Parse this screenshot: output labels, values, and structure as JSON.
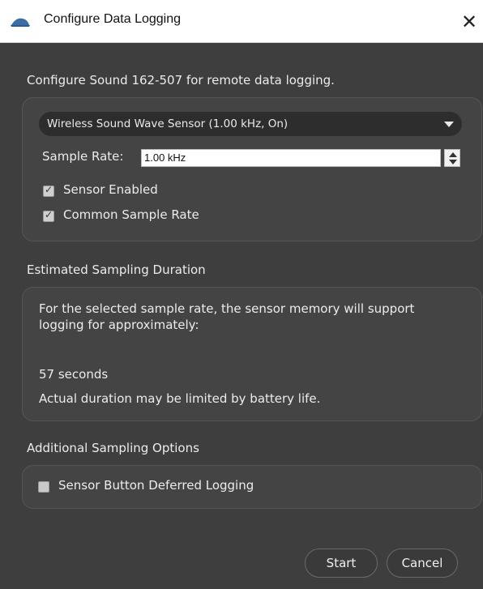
{
  "window": {
    "title": "Configure Data Logging",
    "close_symbol": "✕",
    "icon": "app-logo-icon"
  },
  "intro": {
    "text": "Configure Sound 162-507 for remote data logging."
  },
  "sensor_group": {
    "sensor_select": {
      "selected": "Wireless Sound Wave Sensor (1.00 kHz, On)"
    },
    "sample_rate": {
      "label": "Sample Rate:",
      "value": "1.00 kHz"
    },
    "options": [
      {
        "label": "Sensor Enabled",
        "checked": true
      },
      {
        "label": "Common Sample Rate",
        "checked": true
      }
    ]
  },
  "duration": {
    "heading": "Estimated Sampling Duration",
    "description": "For the selected sample rate, the sensor memory will support logging for approximately:",
    "value": "57 seconds",
    "note": "Actual duration may be limited by battery life."
  },
  "additional": {
    "heading": "Additional Sampling Options",
    "options": [
      {
        "label": "Sensor Button Deferred Logging",
        "checked": false
      }
    ]
  },
  "buttons": {
    "start": "Start",
    "cancel": "Cancel"
  },
  "colors": {
    "background": "#3e3e3e",
    "group": "#444444",
    "text": "#ececec",
    "titlebar": "#ffffff"
  }
}
